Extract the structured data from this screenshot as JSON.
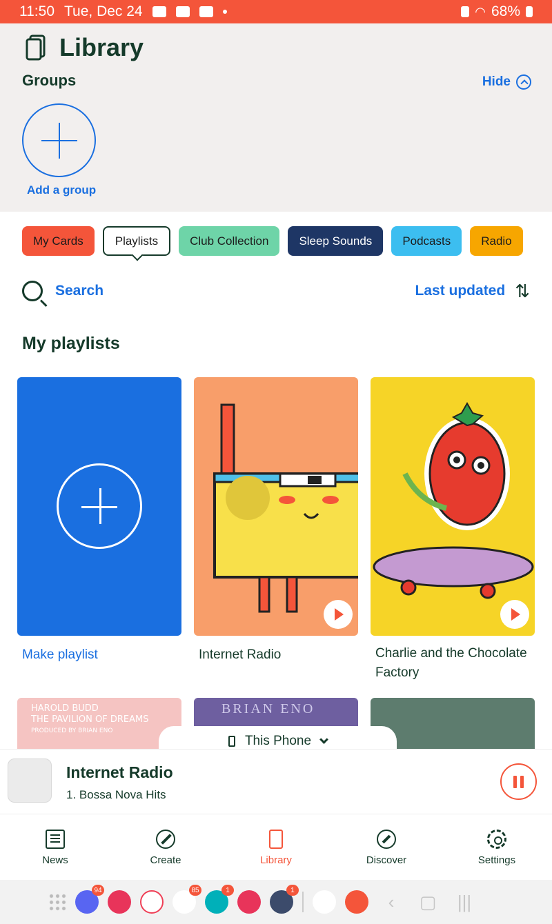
{
  "status_bar": {
    "time": "11:50",
    "date": "Tue, Dec 24",
    "battery": "68%"
  },
  "header": {
    "title": "Library",
    "groups_label": "Groups",
    "hide_label": "Hide",
    "add_group_label": "Add a group"
  },
  "chips": [
    "My Cards",
    "Playlists",
    "Club Collection",
    "Sleep Sounds",
    "Podcasts",
    "Radio"
  ],
  "search": {
    "label": "Search",
    "sort_label": "Last updated"
  },
  "section_title": "My playlists",
  "cards": {
    "make_playlist": "Make playlist",
    "internet_radio": "Internet Radio",
    "charlie": "Charlie and the Chocolate Factory"
  },
  "lower_cards": {
    "budd_line1": "HAROLD BUDD",
    "budd_line2": "THE PAVILION OF DREAMS",
    "budd_line3": "PRODUCED BY BRIAN ENO",
    "eno": "BRIAN ENO"
  },
  "device": {
    "label": "This Phone"
  },
  "player": {
    "title": "Internet Radio",
    "subtitle": "1. Bossa Nova Hits"
  },
  "nav": {
    "news": "News",
    "create": "Create",
    "library": "Library",
    "discover": "Discover",
    "settings": "Settings"
  },
  "dock": {
    "discord_badge": "94",
    "youtube_badge": "85",
    "fitbit_badge": "1",
    "settings_badge": "1"
  },
  "colors": {
    "accent": "#f4553a",
    "link": "#1a6fe0",
    "text": "#153a2a"
  }
}
